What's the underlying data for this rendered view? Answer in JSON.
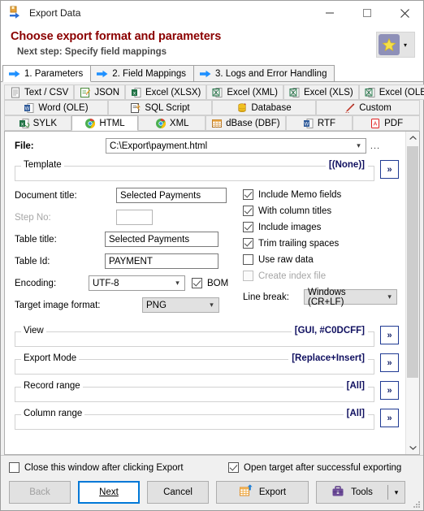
{
  "window": {
    "title": "Export Data",
    "icon": "export-data-icon",
    "minimize": "minimize-icon",
    "maximize": "maximize-icon",
    "close": "close-icon"
  },
  "header": {
    "title": "Choose export format and parameters",
    "subtitle": "Next step: Specify field mappings",
    "favorite_icon": "star-icon",
    "favorite_caret": "▾"
  },
  "step_tabs": [
    {
      "label": "1. Parameters",
      "icon": "blue-arrow-icon",
      "active": true
    },
    {
      "label": "2. Field Mappings",
      "icon": "blue-arrow-icon",
      "active": false
    },
    {
      "label": "3. Logs and Error Handling",
      "icon": "blue-arrow-icon",
      "active": false
    }
  ],
  "format_tabs": {
    "row1": [
      {
        "label": "Text / CSV",
        "icon": "text-file-icon"
      },
      {
        "label": "JSON",
        "icon": "json-note-icon"
      },
      {
        "label": "Excel (XLSX)",
        "icon": "excel-icon"
      },
      {
        "label": "Excel (XML)",
        "icon": "excel-xml-icon"
      },
      {
        "label": "Excel (XLS)",
        "icon": "excel-xls-icon"
      },
      {
        "label": "Excel (OLE)",
        "icon": "excel-ole-icon"
      }
    ],
    "row2": [
      {
        "label": "Word (OLE)",
        "icon": "word-icon"
      },
      {
        "label": "SQL Script",
        "icon": "sql-script-icon"
      },
      {
        "label": "Database",
        "icon": "database-icon"
      },
      {
        "label": "Custom",
        "icon": "pencil-icon"
      }
    ],
    "row3": [
      {
        "label": "SYLK",
        "icon": "sylk-icon",
        "selected": false
      },
      {
        "label": "HTML",
        "icon": "chrome-icon",
        "selected": true
      },
      {
        "label": "XML",
        "icon": "chrome-xml-icon",
        "selected": false
      },
      {
        "label": "dBase (DBF)",
        "icon": "dbase-table-icon",
        "selected": false
      },
      {
        "label": "RTF",
        "icon": "word-rtf-icon",
        "selected": false
      },
      {
        "label": "PDF",
        "icon": "pdf-icon",
        "selected": false
      }
    ]
  },
  "form": {
    "file_label": "File:",
    "file_value": "C:\\Export\\payment.html",
    "file_browse": "...",
    "template_group": {
      "name": "Template",
      "value": "[(None)]",
      "expand": "»"
    },
    "document_title_label": "Document title:",
    "document_title_value": "Selected Payments",
    "step_no_label": "Step No:",
    "step_no_value": "",
    "table_title_label": "Table title:",
    "table_title_value": "Selected Payments",
    "table_id_label": "Table Id:",
    "table_id_value": "PAYMENT",
    "encoding_label": "Encoding:",
    "encoding_value": "UTF-8",
    "bom_label": "BOM",
    "target_image_label": "Target image format:",
    "target_image_value": "PNG",
    "line_break_label": "Line break:",
    "line_break_value": "Windows (CR+LF)",
    "checkboxes": [
      {
        "label": "Include Memo fields",
        "checked": true,
        "disabled": false
      },
      {
        "label": "With column titles",
        "checked": true,
        "disabled": false
      },
      {
        "label": "Include images",
        "checked": true,
        "disabled": false
      },
      {
        "label": "Trim trailing spaces",
        "checked": true,
        "disabled": false
      },
      {
        "label": "Use raw data",
        "checked": false,
        "disabled": false
      },
      {
        "label": "Create index file",
        "checked": false,
        "disabled": true
      }
    ],
    "groups": [
      {
        "name": "View",
        "value": "[GUI, #C0DCFF]",
        "expand": "»"
      },
      {
        "name": "Export Mode",
        "value": "[Replace+Insert]",
        "expand": "»"
      },
      {
        "name": "Record range",
        "value": "[All]",
        "expand": "»"
      },
      {
        "name": "Column range",
        "value": "[All]",
        "expand": "»"
      }
    ]
  },
  "scrollbar": {
    "up": "⌃",
    "down": "⌄"
  },
  "footer": {
    "close_window_label": "Close this window after clicking Export",
    "close_window_checked": false,
    "open_target_label": "Open target after successful exporting",
    "open_target_checked": true,
    "back_label": "Back",
    "back_accel": "B",
    "next_label": "Next",
    "next_accel": "N",
    "cancel_label": "Cancel",
    "export_label": "Export",
    "export_icon": "export-table-icon",
    "tools_label": "Tools",
    "tools_icon": "briefcase-icon",
    "tools_caret": "▾"
  },
  "colors": {
    "header_title": "#8b0000",
    "accent_blue": "#0078d7",
    "group_value": "#101060"
  }
}
